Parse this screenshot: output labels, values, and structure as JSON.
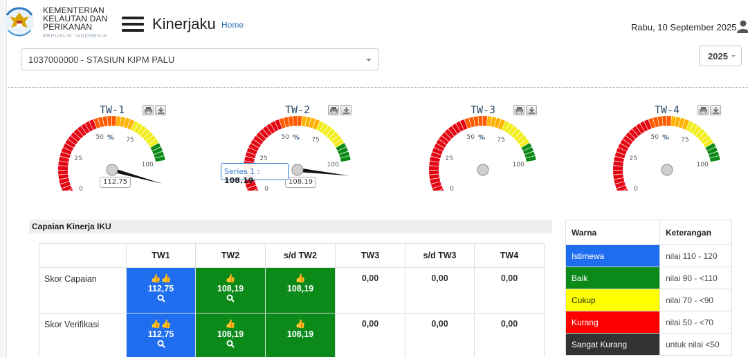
{
  "header": {
    "org_lines": [
      "KEMENTERIAN",
      "KELAUTAN DAN",
      "PERIKANAN"
    ],
    "org_sub": "REPUBLIK INDONESIA",
    "app_title": "Kinerjaku",
    "home_link": "Home",
    "date": "Rabu, 10 September 2025"
  },
  "filters": {
    "unit": "1037000000 - STASIUN KIPM PALU",
    "year": "2025"
  },
  "gauges": [
    {
      "title": "TW-1",
      "value": 112.75,
      "value_label": "112.75",
      "ticks": [
        "0",
        "25",
        "50",
        "75",
        "100"
      ],
      "unit": "%"
    },
    {
      "title": "TW-2",
      "value": 108.19,
      "value_label": "108.19",
      "ticks": [
        "0",
        "25",
        "50",
        "75",
        "100"
      ],
      "unit": "%"
    },
    {
      "title": "TW-3",
      "value": null,
      "value_label": "",
      "ticks": [
        "0",
        "25",
        "50",
        "75",
        "100"
      ],
      "unit": "%"
    },
    {
      "title": "TW-4",
      "value": null,
      "value_label": "",
      "ticks": [
        "0",
        "25",
        "50",
        "75",
        "100"
      ],
      "unit": "%"
    }
  ],
  "tooltip": {
    "series": "Series 1 :",
    "value": "108.19"
  },
  "iku": {
    "title": "Capaian Kinerja IKU",
    "columns": [
      "",
      "TW1",
      "TW2",
      "s/d TW2",
      "TW3",
      "s/d TW3",
      "TW4"
    ],
    "rows": [
      {
        "label": "Skor Capaian",
        "cells": [
          "112,75",
          "108,19",
          "108,19",
          "0,00",
          "0,00",
          "0,00"
        ]
      },
      {
        "label": "Skor Verifikasi",
        "cells": [
          "112,75",
          "108,19",
          "108,19",
          "0,00",
          "0,00",
          "0,00"
        ]
      }
    ],
    "colors": {
      "blue": "#1f6ef0",
      "green": "#0b8a1a"
    }
  },
  "legend": {
    "headers": [
      "Warna",
      "Keterangan"
    ],
    "rows": [
      {
        "name": "Istimewa",
        "desc": "nilai 110 - 120",
        "color": "#1f6ef0",
        "text": "#ffffff"
      },
      {
        "name": "Baik",
        "desc": "nilai 90 - <110",
        "color": "#0b8a1a",
        "text": "#ffffff"
      },
      {
        "name": "Cukup",
        "desc": "nilai 70 - <90",
        "color": "#ffff00",
        "text": "#222222"
      },
      {
        "name": "Kurang",
        "desc": "nilai 50 - <70",
        "color": "#ff0000",
        "text": "#ffffff"
      },
      {
        "name": "Sangat Kurang",
        "desc": "untuk nilai <50",
        "color": "#333333",
        "text": "#ffffff"
      }
    ]
  }
}
